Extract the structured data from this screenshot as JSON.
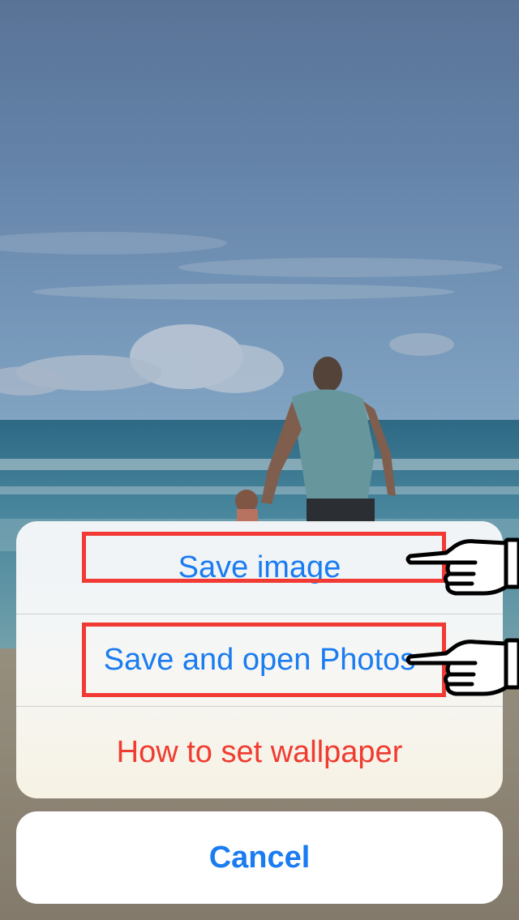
{
  "wallpaper": {
    "description_icon": "beach-photo"
  },
  "action_sheet": {
    "actions": [
      {
        "label": "Save image",
        "color": "#1a7cf0"
      },
      {
        "label": "Save and open Photos",
        "color": "#1a7cf0"
      },
      {
        "label": "How to set wallpaper",
        "color": "#f13b30"
      }
    ],
    "cancel_label": "Cancel"
  },
  "annotations": {
    "highlight_color": "#f23a35",
    "pointer_icon": "pointing-hand-icon"
  }
}
